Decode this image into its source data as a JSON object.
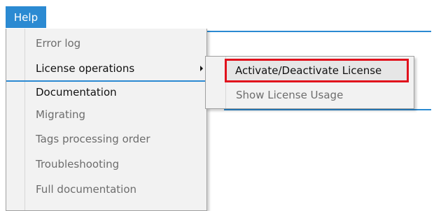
{
  "menubar": {
    "help_label": "Help"
  },
  "help_menu": {
    "items": [
      {
        "label": "Error log",
        "state": "disabled"
      },
      {
        "label": "License operations",
        "state": "enabled",
        "has_submenu": true
      },
      {
        "label": "Documentation",
        "state": "enabled"
      },
      {
        "label": "Migrating",
        "state": "disabled"
      },
      {
        "label": "Tags processing order",
        "state": "disabled"
      },
      {
        "label": "Troubleshooting",
        "state": "disabled"
      },
      {
        "label": "Full documentation",
        "state": "disabled"
      }
    ]
  },
  "license_submenu": {
    "items": [
      {
        "label": "Activate/Deactivate License",
        "state": "highlighted"
      },
      {
        "label": "Show License Usage",
        "state": "disabled"
      }
    ]
  },
  "colors": {
    "accent": "#2b8ad2",
    "highlight_border": "#e1121d",
    "menu_bg": "#f2f2f2"
  }
}
